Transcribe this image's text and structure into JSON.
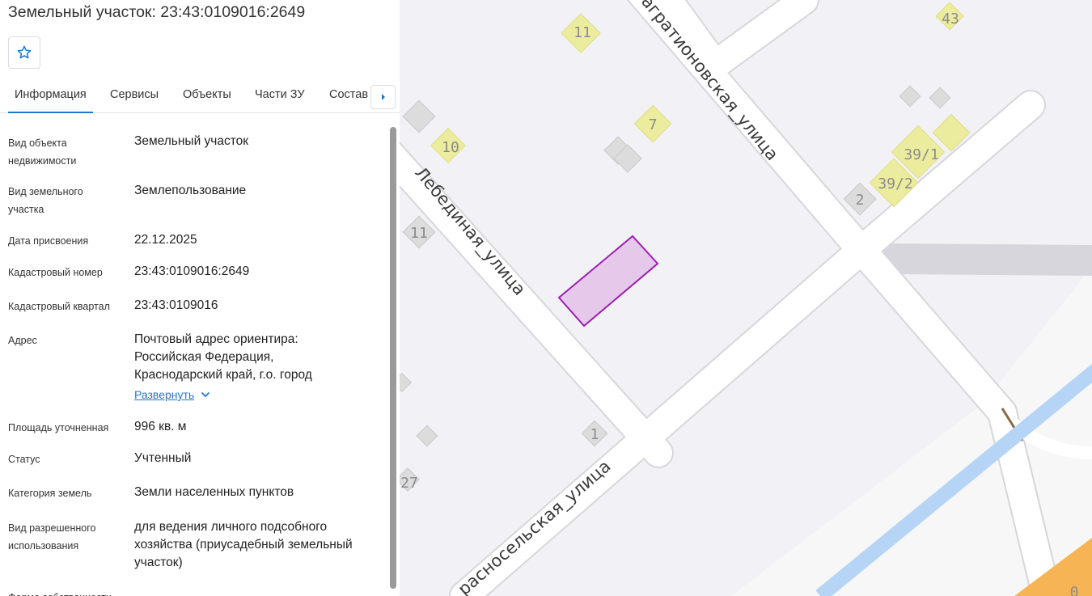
{
  "header": {
    "title": "Земельный участок: 23:43:0109016:2649",
    "favorite_icon": "star-outline-icon"
  },
  "tabs": [
    {
      "label": "Информация",
      "active": true
    },
    {
      "label": "Сервисы",
      "active": false
    },
    {
      "label": "Объекты",
      "active": false
    },
    {
      "label": "Части ЗУ",
      "active": false
    },
    {
      "label": "Состав",
      "active": false
    }
  ],
  "fields": [
    {
      "label": "Вид объекта недвижимости",
      "value": "Земельный участок"
    },
    {
      "label": "Вид земельного участка",
      "value": "Землепользование"
    },
    {
      "label": "Дата присвоения",
      "value": "22.12.2025"
    },
    {
      "label": "Кадастровый номер",
      "value": "23:43:0109016:2649"
    },
    {
      "label": "Кадастровый квартал",
      "value": "23:43:0109016"
    },
    {
      "label": "Адрес",
      "value": "Почтовый адрес ориентира: Российская Федерация, Краснодарский край, г.о. город"
    },
    {
      "label": "Площадь уточненная",
      "value": "996 кв. м"
    },
    {
      "label": "Статус",
      "value": "Учтенный"
    },
    {
      "label": "Категория земель",
      "value": "Земли населенных пунктов"
    },
    {
      "label": "Вид разрешенного использования",
      "value": "для ведения личного подсобного хозяйства (приусадебный земельный участок)"
    },
    {
      "label": "Форма собственности",
      "value": ""
    }
  ],
  "address_expand_label": "Развернуть",
  "map": {
    "streets": [
      {
        "name": "Лебединая_улица"
      },
      {
        "name": "агратионовская_улица"
      },
      {
        "name": "расносельская_улица"
      }
    ],
    "house_numbers": [
      "11",
      "43",
      "7",
      "10",
      "39/1",
      "39/2",
      "2",
      "11",
      "1",
      "27",
      "0"
    ],
    "colors": {
      "background": "#f2f2f6",
      "road": "#ffffff",
      "road_edge": "#d6d6dc",
      "building_yellow": "#ecec9e",
      "building_grey": "#dcdcdc",
      "parcel_fill": "#e6c8ea",
      "parcel_stroke": "#9b1fae",
      "water": "#b5d4f6",
      "orange": "#f6b454"
    }
  }
}
